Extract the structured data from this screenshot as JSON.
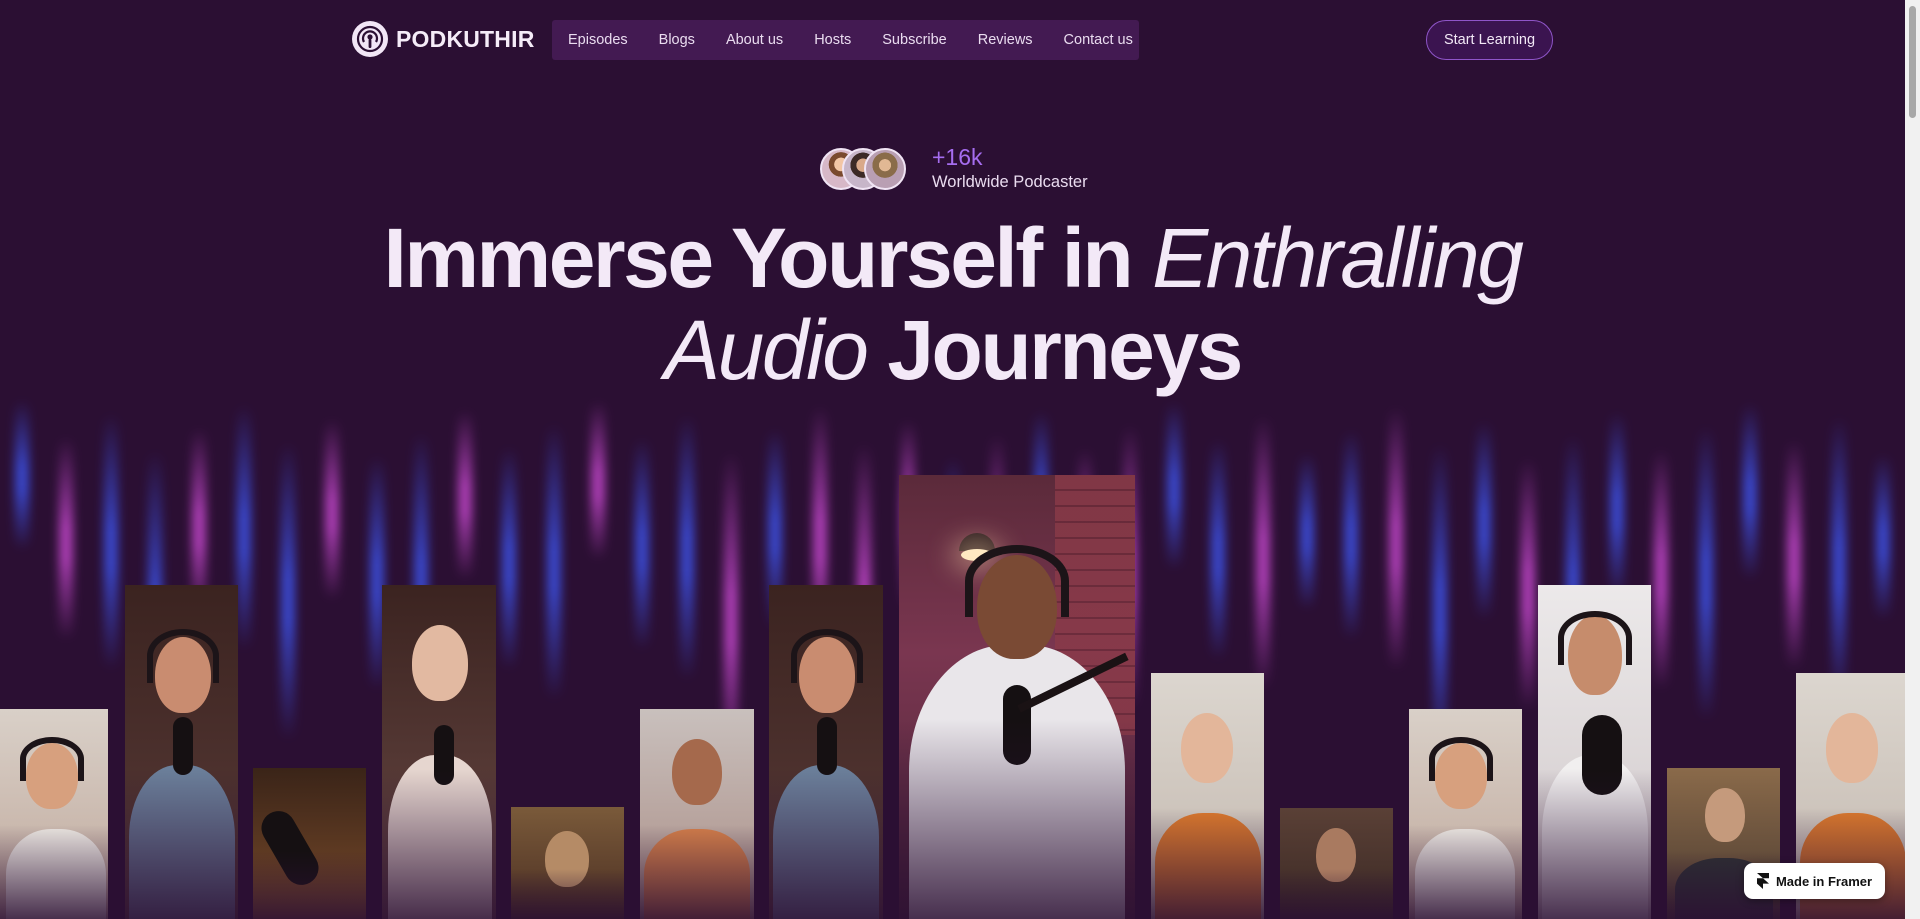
{
  "brand": {
    "name": "PODKUTHIR",
    "logo_icon": "podcast-signal-icon"
  },
  "nav": {
    "items": [
      {
        "label": "Episodes"
      },
      {
        "label": "Blogs"
      },
      {
        "label": "About us"
      },
      {
        "label": "Hosts"
      },
      {
        "label": "Subscribe"
      },
      {
        "label": "Reviews"
      },
      {
        "label": "Contact us"
      }
    ]
  },
  "cta": {
    "label": "Start Learning"
  },
  "proof": {
    "count": "+16k",
    "label": "Worldwide Podcaster"
  },
  "headline": {
    "part1": "Immerse Yourself in ",
    "part2_italic": "Enthralling",
    "part3_italic": "Audio",
    "part4": " Journeys"
  },
  "framer_badge": {
    "label": "Made in Framer",
    "icon": "framer-logo-icon"
  },
  "colors": {
    "background": "#2b0f33",
    "nav_bg": "#431a52",
    "accent": "#a66df0",
    "beam_blue": "#3f5bff",
    "beam_pink": "#d84fe0"
  }
}
